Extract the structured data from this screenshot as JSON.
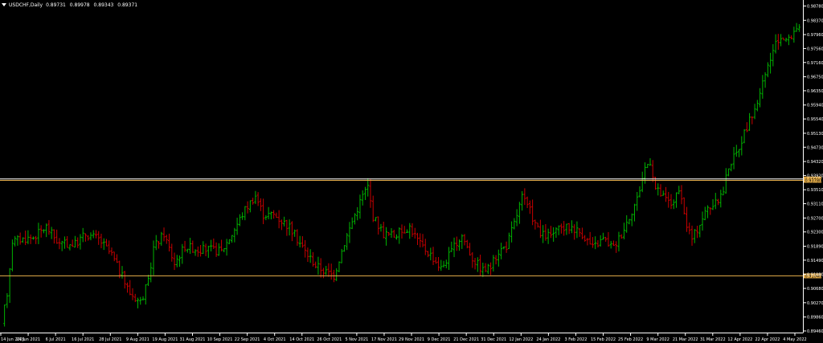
{
  "chart": {
    "symbol": "USDCHF,Daily",
    "ohlc": {
      "open": "0.89731",
      "high": "0.89978",
      "low": "0.89343",
      "close": "0.89371"
    },
    "background": "#000000",
    "grid": false,
    "up_color": "#00b400",
    "down_color": "#c80000",
    "price_ticks": [
      "0.98780",
      "0.98370",
      "0.97960",
      "0.97560",
      "0.97160",
      "0.96750",
      "0.96350",
      "0.95940",
      "0.95540",
      "0.95130",
      "0.94730",
      "0.94320",
      "0.93920",
      "0.93510",
      "0.93110",
      "0.92700",
      "0.92300",
      "0.91890",
      "0.91490",
      "0.91080",
      "0.90680",
      "0.90270",
      "0.89860",
      "0.89460"
    ],
    "date_ticks": [
      "14 Jun 2021",
      "24 Jun 2021",
      "6 Jul 2021",
      "16 Jul 2021",
      "28 Jul 2021",
      "9 Aug 2021",
      "19 Aug 2021",
      "31 Aug 2021",
      "10 Sep 2021",
      "22 Sep 2021",
      "4 Oct 2021",
      "14 Oct 2021",
      "26 Oct 2021",
      "5 Nov 2021",
      "17 Nov 2021",
      "29 Nov 2021",
      "9 Dec 2021",
      "21 Dec 2021",
      "31 Dec 2021",
      "12 Jan 2022",
      "24 Jan 2022",
      "3 Feb 2022",
      "15 Feb 2022",
      "25 Feb 2022",
      "9 Mar 2022",
      "21 Mar 2022",
      "31 Mar 2022",
      "12 Apr 2022",
      "22 Apr 2022",
      "4 May 2022"
    ],
    "levels": [
      {
        "price": 0.9382,
        "label": "0.93819",
        "color": "#ffffff",
        "tag_color": "#e8b04b"
      },
      {
        "price": 0.9378,
        "label": "0.93780",
        "color": "#e8b04b",
        "tag_color": "#e8b04b"
      },
      {
        "price": 0.9104,
        "label": "0.91040",
        "color": "#e8b04b",
        "tag_color": "#e8b04b"
      }
    ],
    "y_range": [
      0.8946,
      0.9886
    ],
    "chart_data": {
      "type": "ohlc",
      "x_start": "14 Jun 2021",
      "anchors": [
        [
          0,
          0.8965
        ],
        [
          2,
          0.9055
        ],
        [
          4,
          0.9205
        ],
        [
          12,
          0.9215
        ],
        [
          17,
          0.9245
        ],
        [
          22,
          0.9195
        ],
        [
          28,
          0.9195
        ],
        [
          32,
          0.9225
        ],
        [
          37,
          0.921
        ],
        [
          42,
          0.9165
        ],
        [
          47,
          0.9085
        ],
        [
          49,
          0.9055
        ],
        [
          53,
          0.903
        ],
        [
          56,
          0.9085
        ],
        [
          58,
          0.9185
        ],
        [
          62,
          0.9225
        ],
        [
          66,
          0.914
        ],
        [
          70,
          0.919
        ],
        [
          75,
          0.918
        ],
        [
          79,
          0.918
        ],
        [
          84,
          0.9175
        ],
        [
          88,
          0.9225
        ],
        [
          93,
          0.9295
        ],
        [
          97,
          0.9335
        ],
        [
          100,
          0.928
        ],
        [
          104,
          0.928
        ],
        [
          110,
          0.9245
        ],
        [
          116,
          0.9175
        ],
        [
          120,
          0.9135
        ],
        [
          124,
          0.9115
        ],
        [
          127,
          0.9105
        ],
        [
          131,
          0.92
        ],
        [
          135,
          0.928
        ],
        [
          138,
          0.9335
        ],
        [
          140,
          0.936
        ],
        [
          142,
          0.9275
        ],
        [
          146,
          0.9225
        ],
        [
          150,
          0.922
        ],
        [
          156,
          0.9245
        ],
        [
          160,
          0.9195
        ],
        [
          164,
          0.9165
        ],
        [
          168,
          0.9125
        ],
        [
          172,
          0.9175
        ],
        [
          176,
          0.922
        ],
        [
          180,
          0.9155
        ],
        [
          184,
          0.912
        ],
        [
          187,
          0.913
        ],
        [
          190,
          0.9175
        ],
        [
          193,
          0.919
        ],
        [
          196,
          0.9255
        ],
        [
          199,
          0.933
        ],
        [
          202,
          0.929
        ],
        [
          206,
          0.922
        ],
        [
          210,
          0.922
        ],
        [
          214,
          0.924
        ],
        [
          218,
          0.9245
        ],
        [
          222,
          0.9225
        ],
        [
          226,
          0.9185
        ],
        [
          230,
          0.921
        ],
        [
          234,
          0.9185
        ],
        [
          237,
          0.9225
        ],
        [
          240,
          0.9275
        ],
        [
          243,
          0.9325
        ],
        [
          246,
          0.9415
        ],
        [
          248,
          0.9435
        ],
        [
          250,
          0.9355
        ],
        [
          253,
          0.933
        ],
        [
          256,
          0.931
        ],
        [
          259,
          0.9345
        ],
        [
          262,
          0.925
        ],
        [
          264,
          0.921
        ],
        [
          267,
          0.9255
        ],
        [
          270,
          0.93
        ],
        [
          273,
          0.931
        ],
        [
          276,
          0.935
        ],
        [
          278,
          0.942
        ],
        [
          281,
          0.9455
        ],
        [
          284,
          0.9515
        ],
        [
          287,
          0.9565
        ],
        [
          290,
          0.9625
        ],
        [
          293,
          0.9705
        ],
        [
          296,
          0.9765
        ],
        [
          298,
          0.979
        ],
        [
          301,
          0.978
        ],
        [
          304,
          0.982
        ]
      ],
      "bar_count": 305
    }
  }
}
